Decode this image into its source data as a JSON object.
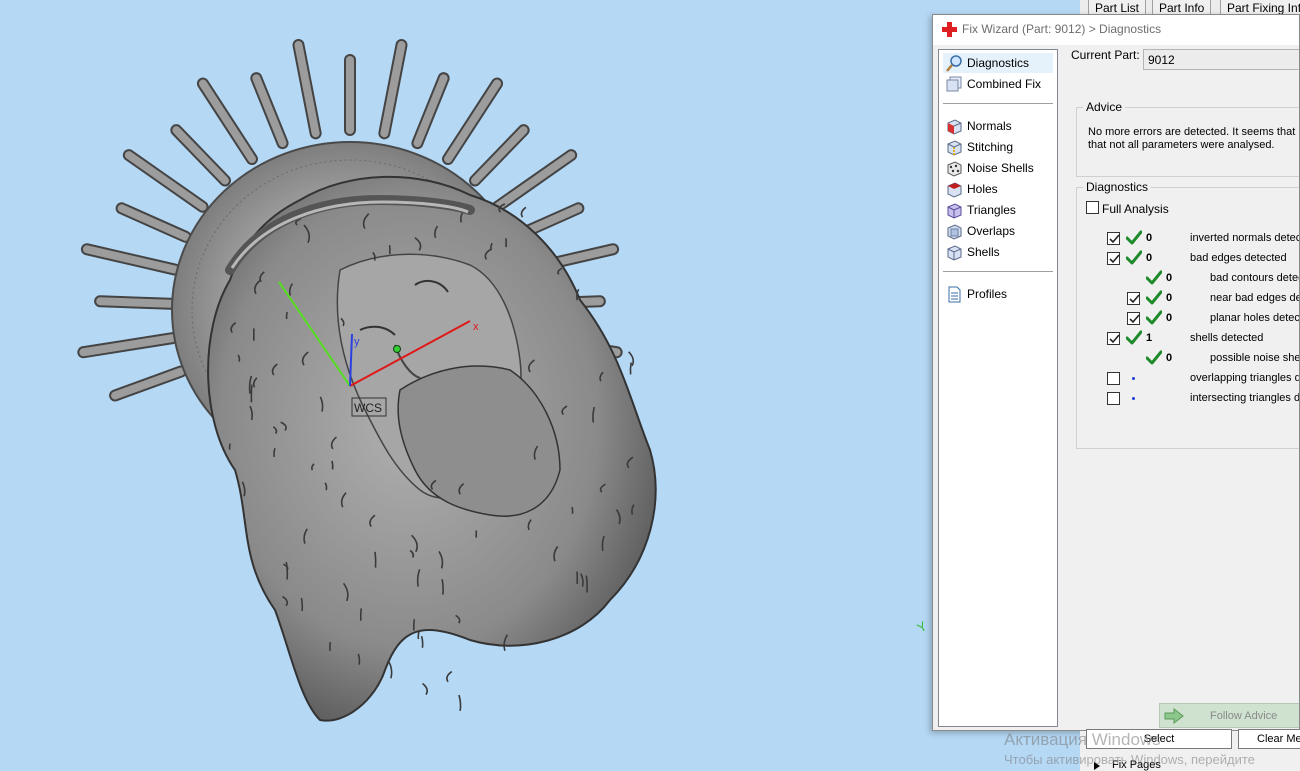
{
  "viewport": {
    "wcs_label": "WCS",
    "axis_x_label": "x",
    "axis_y_label": "y",
    "corner_axis_label": "Y",
    "background_color": "#b5d8f5",
    "model_color": "#8c8c8c"
  },
  "right_panel": {
    "tabs": [
      "Part List",
      "Part Info",
      "Part Fixing Info"
    ]
  },
  "dialog": {
    "title": "Fix Wizard (Part: 9012) > Diagnostics",
    "title_icon": "red-cross-icon",
    "nav": {
      "primary": [
        {
          "label": "Diagnostics",
          "icon": "magnifier-icon",
          "selected": true
        },
        {
          "label": "Combined Fix",
          "icon": "combined-fix-icon",
          "selected": false
        }
      ],
      "fixes": [
        {
          "label": "Normals",
          "icon": "normals-cube-icon"
        },
        {
          "label": "Stitching",
          "icon": "stitching-cube-icon"
        },
        {
          "label": "Noise Shells",
          "icon": "noise-shells-icon"
        },
        {
          "label": "Holes",
          "icon": "holes-cube-icon"
        },
        {
          "label": "Triangles",
          "icon": "triangles-cube-icon"
        },
        {
          "label": "Overlaps",
          "icon": "overlaps-cube-icon"
        },
        {
          "label": "Shells",
          "icon": "shells-cube-icon"
        }
      ],
      "profiles": {
        "label": "Profiles",
        "icon": "profiles-document-icon"
      }
    },
    "current_part": {
      "label": "Current Part:",
      "value": "9012"
    },
    "advice": {
      "title": "Advice",
      "line1": "No more errors are detected. It seems that",
      "line2": "that not all parameters were analysed."
    },
    "diagnostics": {
      "title": "Diagnostics",
      "full_analysis": {
        "label": "Full Analysis",
        "checked": false
      },
      "rows": [
        {
          "checkbox": true,
          "checked": true,
          "status": "ok",
          "count": "0",
          "label": "inverted normals detec",
          "indent": 0
        },
        {
          "checkbox": true,
          "checked": true,
          "status": "ok",
          "count": "0",
          "label": "bad edges detected",
          "indent": 0
        },
        {
          "checkbox": false,
          "checked": false,
          "status": "ok",
          "count": "0",
          "label": "bad contours detec",
          "indent": 1
        },
        {
          "checkbox": true,
          "checked": true,
          "status": "ok",
          "count": "0",
          "label": "near bad edges de",
          "indent": 1
        },
        {
          "checkbox": true,
          "checked": true,
          "status": "ok",
          "count": "0",
          "label": "planar holes detect",
          "indent": 1
        },
        {
          "checkbox": true,
          "checked": true,
          "status": "ok",
          "count": "1",
          "label": "shells detected",
          "indent": 0
        },
        {
          "checkbox": false,
          "checked": false,
          "status": "ok",
          "count": "0",
          "label": "possible noise shell",
          "indent": 1
        },
        {
          "checkbox": true,
          "checked": false,
          "status": "pending",
          "count": "",
          "label": "overlapping triangles d",
          "indent": 0
        },
        {
          "checkbox": true,
          "checked": false,
          "status": "pending",
          "count": "",
          "label": "intersecting triangles d",
          "indent": 0
        }
      ]
    },
    "follow_advice": {
      "label": "Follow Advice",
      "icon": "green-arrow-icon"
    }
  },
  "bottom": {
    "select_label": "Select",
    "clear_label": "Clear Me",
    "fix_pages_label": "Fix Pages"
  },
  "watermark": {
    "line1": "Активация Windows",
    "line2": "Чтобы активировать Windows, перейдите"
  }
}
